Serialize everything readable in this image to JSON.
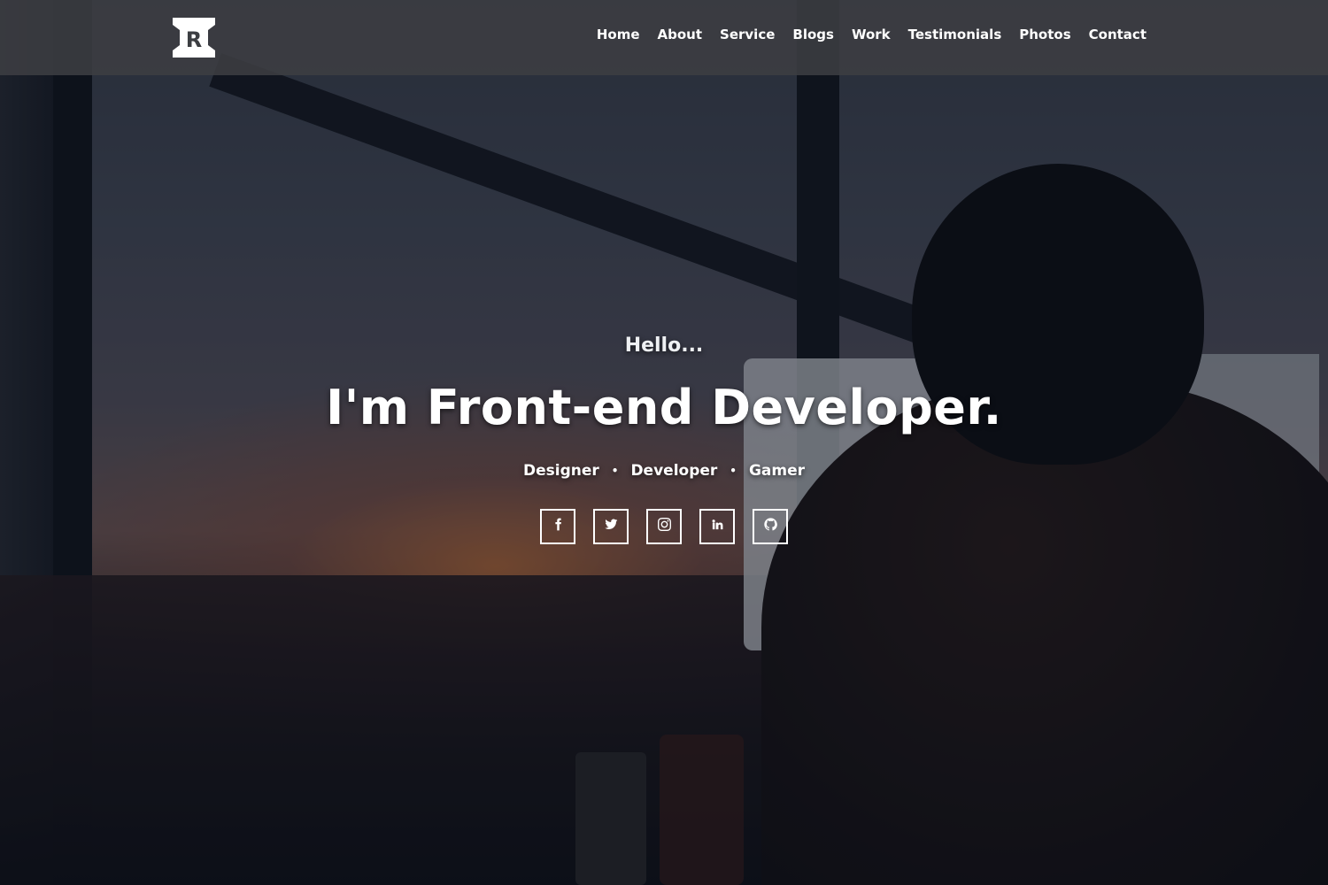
{
  "brand": {
    "logo_letter": "R",
    "logo_icon": "r-monogram-icon"
  },
  "nav": {
    "items": [
      {
        "label": "Home"
      },
      {
        "label": "About"
      },
      {
        "label": "Service"
      },
      {
        "label": "Blogs"
      },
      {
        "label": "Work"
      },
      {
        "label": "Testimonials"
      },
      {
        "label": "Photos"
      },
      {
        "label": "Contact"
      }
    ]
  },
  "hero": {
    "greeting": "Hello...",
    "headline": "I'm Front-end Developer.",
    "roles": [
      "Designer",
      "Developer",
      "Gamer"
    ],
    "separator": "•",
    "socials": [
      {
        "icon": "facebook-icon"
      },
      {
        "icon": "twitter-icon"
      },
      {
        "icon": "instagram-icon"
      },
      {
        "icon": "linkedin-icon"
      },
      {
        "icon": "github-icon"
      }
    ]
  },
  "colors": {
    "nav_background": "#3c3e42",
    "text": "#ffffff"
  }
}
